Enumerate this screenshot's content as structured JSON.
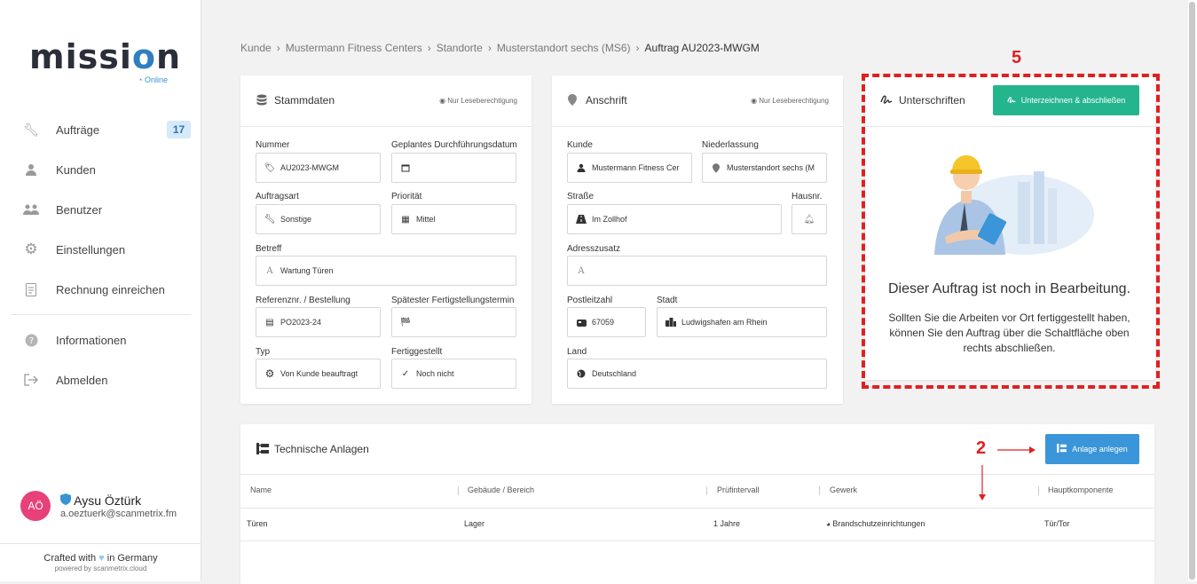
{
  "sidebar": {
    "logo": {
      "part1": "missi",
      "part2": "o",
      "part3": "n"
    },
    "online": "Online",
    "nav": [
      {
        "label": "Aufträge",
        "icon": "wrench-icon",
        "badge": "17"
      },
      {
        "label": "Kunden",
        "icon": "person-icon"
      },
      {
        "label": "Benutzer",
        "icon": "users-icon"
      },
      {
        "label": "Einstellungen",
        "icon": "gear-icon"
      },
      {
        "label": "Rechnung einreichen",
        "icon": "invoice-icon"
      },
      {
        "label": "Informationen",
        "icon": "question-icon"
      },
      {
        "label": "Abmelden",
        "icon": "logout-icon"
      }
    ],
    "user": {
      "initials": "AÖ",
      "name": "Aysu Öztürk",
      "email": "a.oeztuerk@scanmetrix.fm"
    },
    "footer": {
      "crafted_prefix": "Crafted with",
      "crafted_suffix": "in Germany",
      "powered": "powered by scanmetrix.cloud"
    }
  },
  "breadcrumb": [
    "Kunde",
    "Mustermann Fitness Centers",
    "Standorte",
    "Musterstandort sechs (MS6)",
    "Auftrag AU2023-MWGM"
  ],
  "stammdaten": {
    "title": "Stammdaten",
    "readonly": "Nur Leseberechtigung",
    "fields": {
      "nummer": {
        "label": "Nummer",
        "value": "AU2023-MWGM"
      },
      "datum": {
        "label": "Geplantes Durchführungsdatum",
        "value": ""
      },
      "auftragsart": {
        "label": "Auftragsart",
        "value": "Sonstige"
      },
      "prioritaet": {
        "label": "Priorität",
        "value": "Mittel"
      },
      "betreff": {
        "label": "Betreff",
        "value": "Wartung Türen"
      },
      "referenz": {
        "label": "Referenznr. / Bestellung",
        "value": "PO2023-24"
      },
      "fertigstellung": {
        "label": "Spätester Fertigstellungstermin",
        "value": ""
      },
      "typ": {
        "label": "Typ",
        "value": "Von Kunde beauftragt"
      },
      "fertiggestellt": {
        "label": "Fertiggestellt",
        "value": "Noch nicht"
      }
    }
  },
  "anschrift": {
    "title": "Anschrift",
    "readonly": "Nur Leseberechtigung",
    "fields": {
      "kunde": {
        "label": "Kunde",
        "value": "Mustermann Fitness Cer"
      },
      "niederlassung": {
        "label": "Niederlassung",
        "value": "Musterstandort sechs (M"
      },
      "strasse": {
        "label": "Straße",
        "value": "Im Zollhof"
      },
      "hausnr": {
        "label": "Hausnr.",
        "value": ""
      },
      "adresszusatz": {
        "label": "Adresszusatz",
        "value": ""
      },
      "plz": {
        "label": "Postleitzahl",
        "value": "67059"
      },
      "stadt": {
        "label": "Stadt",
        "value": "Ludwigshafen am Rhein"
      },
      "land": {
        "label": "Land",
        "value": "Deutschland"
      }
    }
  },
  "unterschriften": {
    "title": "Unterschriften",
    "button": "Unterzeichnen & abschließen",
    "heading": "Dieser Auftrag ist noch in Bearbeitung.",
    "text": "Sollten Sie die Arbeiten vor Ort fertiggestellt haben, können Sie den Auftrag über die Schaltfläche oben rechts abschließen."
  },
  "anlagen": {
    "title": "Technische Anlagen",
    "button": "Anlage anlegen",
    "columns": [
      "Name",
      "Gebäude / Bereich",
      "Prüfintervall",
      "Gewerk",
      "Hauptkomponente"
    ],
    "rows": [
      {
        "name": "Türen",
        "gebaeude": "Lager",
        "intervall": "1 Jahre",
        "gewerk": "Brandschutzeinrichtungen",
        "haupt": "Tür/Tor"
      }
    ]
  },
  "annotations": {
    "marker5": "5",
    "marker2": "2"
  },
  "colors": {
    "accent_green": "#25b58d",
    "accent_blue": "#3a96d8",
    "annotation_red": "#e02020",
    "avatar": "#e8417a"
  }
}
